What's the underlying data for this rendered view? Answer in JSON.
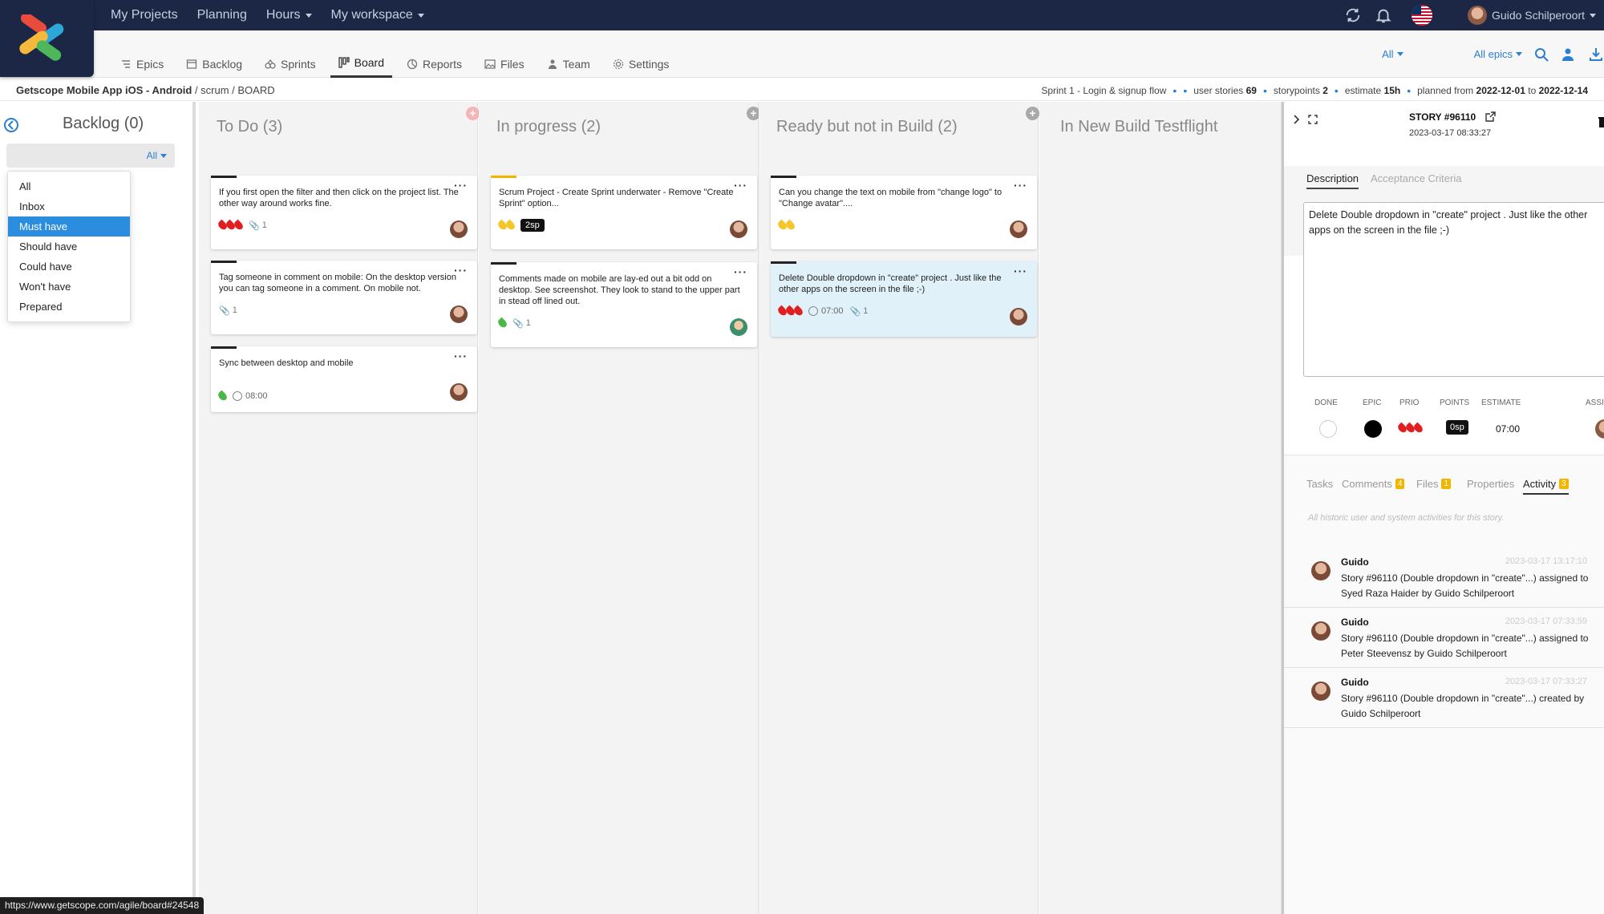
{
  "topnav": {
    "items": [
      {
        "label": "My Projects",
        "dropdown": false
      },
      {
        "label": "Planning",
        "dropdown": false
      },
      {
        "label": "Hours",
        "dropdown": true
      },
      {
        "label": "My workspace",
        "dropdown": true
      }
    ],
    "user_name": "Guido Schilperoort"
  },
  "subnav": {
    "tabs": [
      {
        "label": "Epics",
        "icon": "epics-icon"
      },
      {
        "label": "Backlog",
        "icon": "backlog-icon"
      },
      {
        "label": "Sprints",
        "icon": "sprints-icon"
      },
      {
        "label": "Board",
        "icon": "board-icon",
        "active": true
      },
      {
        "label": "Reports",
        "icon": "reports-icon"
      },
      {
        "label": "Files",
        "icon": "files-icon"
      },
      {
        "label": "Team",
        "icon": "team-icon"
      },
      {
        "label": "Settings",
        "icon": "settings-icon"
      }
    ],
    "filter_all": "All",
    "filter_epics": "All epics"
  },
  "breadcrumb": {
    "project": "Getscope Mobile App iOS - Android",
    "rest": " / scrum / BOARD"
  },
  "sprint_info": {
    "name": "Sprint 1 - Login & signup flow",
    "user_stories_label": "user stories",
    "user_stories": "69",
    "storypoints_label": "storypoints",
    "storypoints": "2",
    "estimate_label": "estimate",
    "estimate": "15h",
    "planned_label": "planned from",
    "from": "2022-12-01",
    "to_label": "to",
    "to": "2022-12-14"
  },
  "backlog": {
    "title": "Backlog (0)",
    "filter": "All",
    "options": [
      "All",
      "Inbox",
      "Must have",
      "Should have",
      "Could have",
      "Won't have",
      "Prepared"
    ],
    "selected": "Must have"
  },
  "columns": [
    {
      "title": "To Do (3)"
    },
    {
      "title": "In progress (2)"
    },
    {
      "title": "Ready but not in Build (2)"
    },
    {
      "title": "In New Build Testflight"
    }
  ],
  "cards": {
    "todo": [
      {
        "text": "If you first open the filter and then click on the project list. The other way around works fine.",
        "attachments": "1"
      },
      {
        "text": "Tag someone in comment on mobile: On the desktop version you can tag someone in a comment. On mobile not.",
        "attachments": "1"
      },
      {
        "text": "Sync between desktop and mobile",
        "time": "08:00"
      }
    ],
    "inprogress": [
      {
        "text": "Scrum Project - Create Sprint underwater - Remove \"Create Sprint\" option...",
        "points": "2sp"
      },
      {
        "text": "Comments made on mobile are lay-ed out a bit odd on desktop. See screenshot. They look to stand to the upper part in stead off lined out.",
        "attachments": "1"
      }
    ],
    "ready": [
      {
        "text": "Can you change the text on mobile from \"change logo\" to \"Change avatar\"...."
      },
      {
        "text": "Delete Double dropdown in \"create\" project . Just like the other apps on the screen in the file ;-)",
        "time": "07:00",
        "attachments": "1"
      }
    ]
  },
  "story": {
    "id": "STORY #96110",
    "date": "2023-03-17 08:33:27",
    "tab_description": "Description",
    "tab_acceptance": "Acceptance Criteria",
    "description": "Delete Double dropdown in \"create\" project . Just like the other apps on the screen in the file ;-)",
    "labels": {
      "done": "DONE",
      "epic": "EPIC",
      "prio": "PRIO",
      "points": "POINTS",
      "estimate": "ESTIMATE",
      "assignee": "ASSI"
    },
    "points": "0sp",
    "estimate": "07:00",
    "lower_tabs": [
      {
        "label": "Tasks"
      },
      {
        "label": "Comments",
        "count": "4"
      },
      {
        "label": "Files",
        "count": "1"
      },
      {
        "label": "Properties"
      },
      {
        "label": "Activity",
        "count": "3",
        "active": true
      }
    ],
    "history_note": "All historic user and system activities for this story.",
    "activity": [
      {
        "name": "Guido",
        "time": "2023-03-17 13:17:10",
        "text": "Story #96110 (Double dropdown in \"create\"...) assigned to Syed Raza Haider by Guido Schilperoort"
      },
      {
        "name": "Guido",
        "time": "2023-03-17 07:33:59",
        "text": "Story #96110 (Double dropdown in \"create\"...) assigned to Peter Steevensz by Guido Schilperoort"
      },
      {
        "name": "Guido",
        "time": "2023-03-17 07:33:27",
        "text": "Story #96110 (Double dropdown in \"create\"...) created by Guido Schilperoort"
      }
    ]
  },
  "status_url": "https://www.getscope.com/agile/board#24548",
  "colors": {
    "navy": "#1b2744",
    "accent_blue": "#2a8dde",
    "badge_yellow": "#f2b600"
  }
}
